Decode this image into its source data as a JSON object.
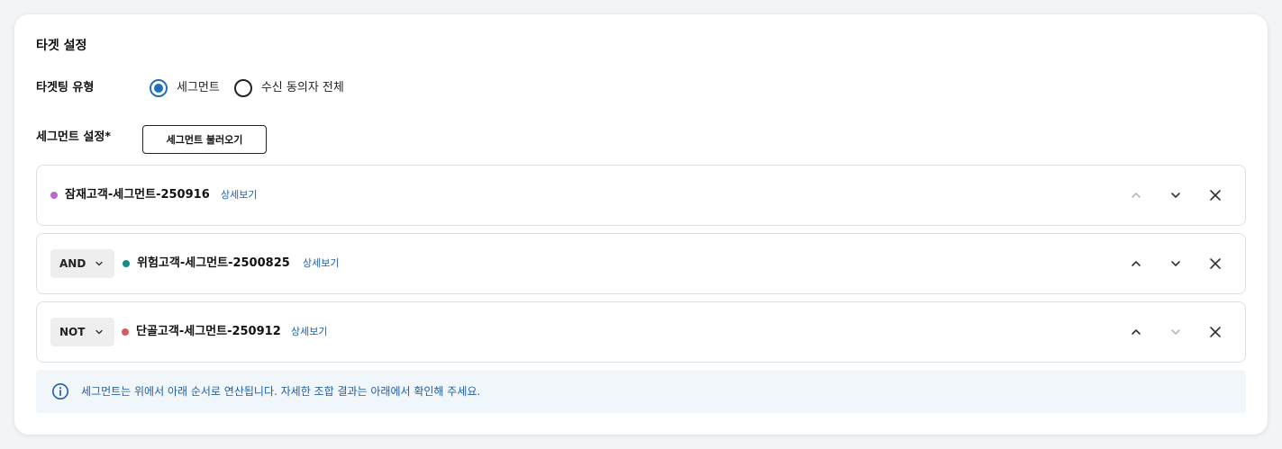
{
  "section": {
    "title": "타겟 설정"
  },
  "targeting_type": {
    "label": "타겟팅 유형",
    "options": [
      {
        "label": "세그먼트",
        "checked": true
      },
      {
        "label": "수신 동의자 전체",
        "checked": false
      }
    ]
  },
  "segment_setting": {
    "label": "세그먼트 설정*",
    "load_button_label": "세그먼트 불러오기"
  },
  "segments": [
    {
      "operator": null,
      "name": "잠재고객-세그먼트-250916",
      "dot_color": "#b86bc8",
      "detail_label": "상세보기",
      "up_enabled": false,
      "down_enabled": true
    },
    {
      "operator": "AND",
      "name": "위험고객-세그먼트-2500825",
      "dot_color": "#138c8a",
      "detail_label": "상세보기",
      "up_enabled": true,
      "down_enabled": true
    },
    {
      "operator": "NOT",
      "name": "단골고객-세그먼트-250912",
      "dot_color": "#d95b5b",
      "detail_label": "상세보기",
      "up_enabled": true,
      "down_enabled": false
    }
  ],
  "info": {
    "text": "세그먼트는 위에서 아래 순서로 연산됩니다. 자세한 조합 결과는 아래에서 확인해 주세요.",
    "icon": "info-circle-icon"
  },
  "colors": {
    "accent": "#1f6fbf",
    "link": "#1f5fa8",
    "info_bg": "#f1f6fb",
    "disabled_icon": "#b5b9bf",
    "enabled_icon": "#333333"
  }
}
